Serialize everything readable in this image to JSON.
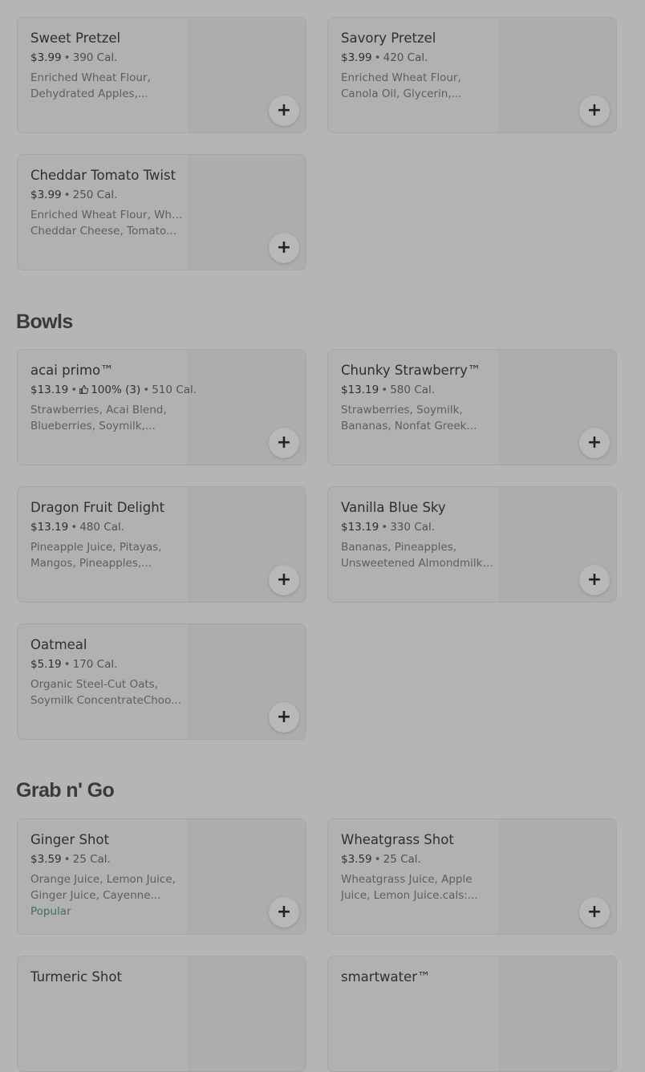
{
  "sections": [
    {
      "title": "",
      "items": [
        {
          "name": "Sweet Pretzel",
          "price": "$3.99",
          "rating": "",
          "calories": "390 Cal.",
          "desc1": "Enriched Wheat Flour,",
          "desc2": "Dehydrated Apples,...",
          "badge": ""
        },
        {
          "name": "Savory Pretzel",
          "price": "$3.99",
          "rating": "",
          "calories": "420 Cal.",
          "desc1": "Enriched Wheat Flour,",
          "desc2": "Canola Oil, Glycerin,...",
          "badge": ""
        },
        {
          "name": "Cheddar Tomato Twist",
          "price": "$3.99",
          "rating": "",
          "calories": "250 Cal.",
          "desc1": "Enriched Wheat Flour, White",
          "desc2": "Cheddar Cheese, Tomato...",
          "badge": ""
        }
      ]
    },
    {
      "title": "Bowls",
      "items": [
        {
          "name": "acai primo™",
          "price": "$13.19",
          "rating": "100% (3)",
          "calories": "510 Cal.",
          "desc1": "Strawberries, Acai Blend,",
          "desc2": "Blueberries, Soymilk,...",
          "badge": ""
        },
        {
          "name": "Chunky Strawberry™",
          "price": "$13.19",
          "rating": "",
          "calories": "580 Cal.",
          "desc1": "Strawberries, Soymilk,",
          "desc2": "Bananas, Nonfat Greek...",
          "badge": ""
        },
        {
          "name": "Dragon Fruit Delight",
          "price": "$13.19",
          "rating": "",
          "calories": "480 Cal.",
          "desc1": "Pineapple Juice, Pitayas,",
          "desc2": "Mangos, Pineapples,...",
          "badge": ""
        },
        {
          "name": "Vanilla Blue Sky",
          "price": "$13.19",
          "rating": "",
          "calories": "330 Cal.",
          "desc1": "Bananas, Pineapples,",
          "desc2": "Unsweetened Almondmilk,...",
          "badge": ""
        },
        {
          "name": "Oatmeal",
          "price": "$5.19",
          "rating": "",
          "calories": "170 Cal.",
          "desc1": "Organic Steel-Cut Oats,",
          "desc2": "Soymilk ConcentrateChoo...",
          "badge": ""
        }
      ]
    },
    {
      "title": "Grab n' Go",
      "items": [
        {
          "name": "Ginger Shot",
          "price": "$3.59",
          "rating": "",
          "calories": "25 Cal.",
          "desc1": "Orange Juice, Lemon Juice,",
          "desc2": "Ginger Juice, Cayenne...",
          "badge": "Popular"
        },
        {
          "name": "Wheatgrass Shot",
          "price": "$3.59",
          "rating": "",
          "calories": "25 Cal.",
          "desc1": "Wheatgrass Juice, Apple",
          "desc2": "Juice, Lemon Juice.cals:...",
          "badge": ""
        },
        {
          "name": "Turmeric Shot",
          "price": "",
          "rating": "",
          "calories": "",
          "desc1": "",
          "desc2": "",
          "badge": ""
        },
        {
          "name": "smartwater™",
          "price": "",
          "rating": "",
          "calories": "",
          "desc1": "",
          "desc2": "",
          "badge": ""
        }
      ]
    }
  ],
  "add_button_symbol": "+",
  "separator": "•",
  "rating_icon": "thumbs-up-icon",
  "colors": {
    "badge": "#41724f",
    "overlay": "#b5b5b5"
  }
}
